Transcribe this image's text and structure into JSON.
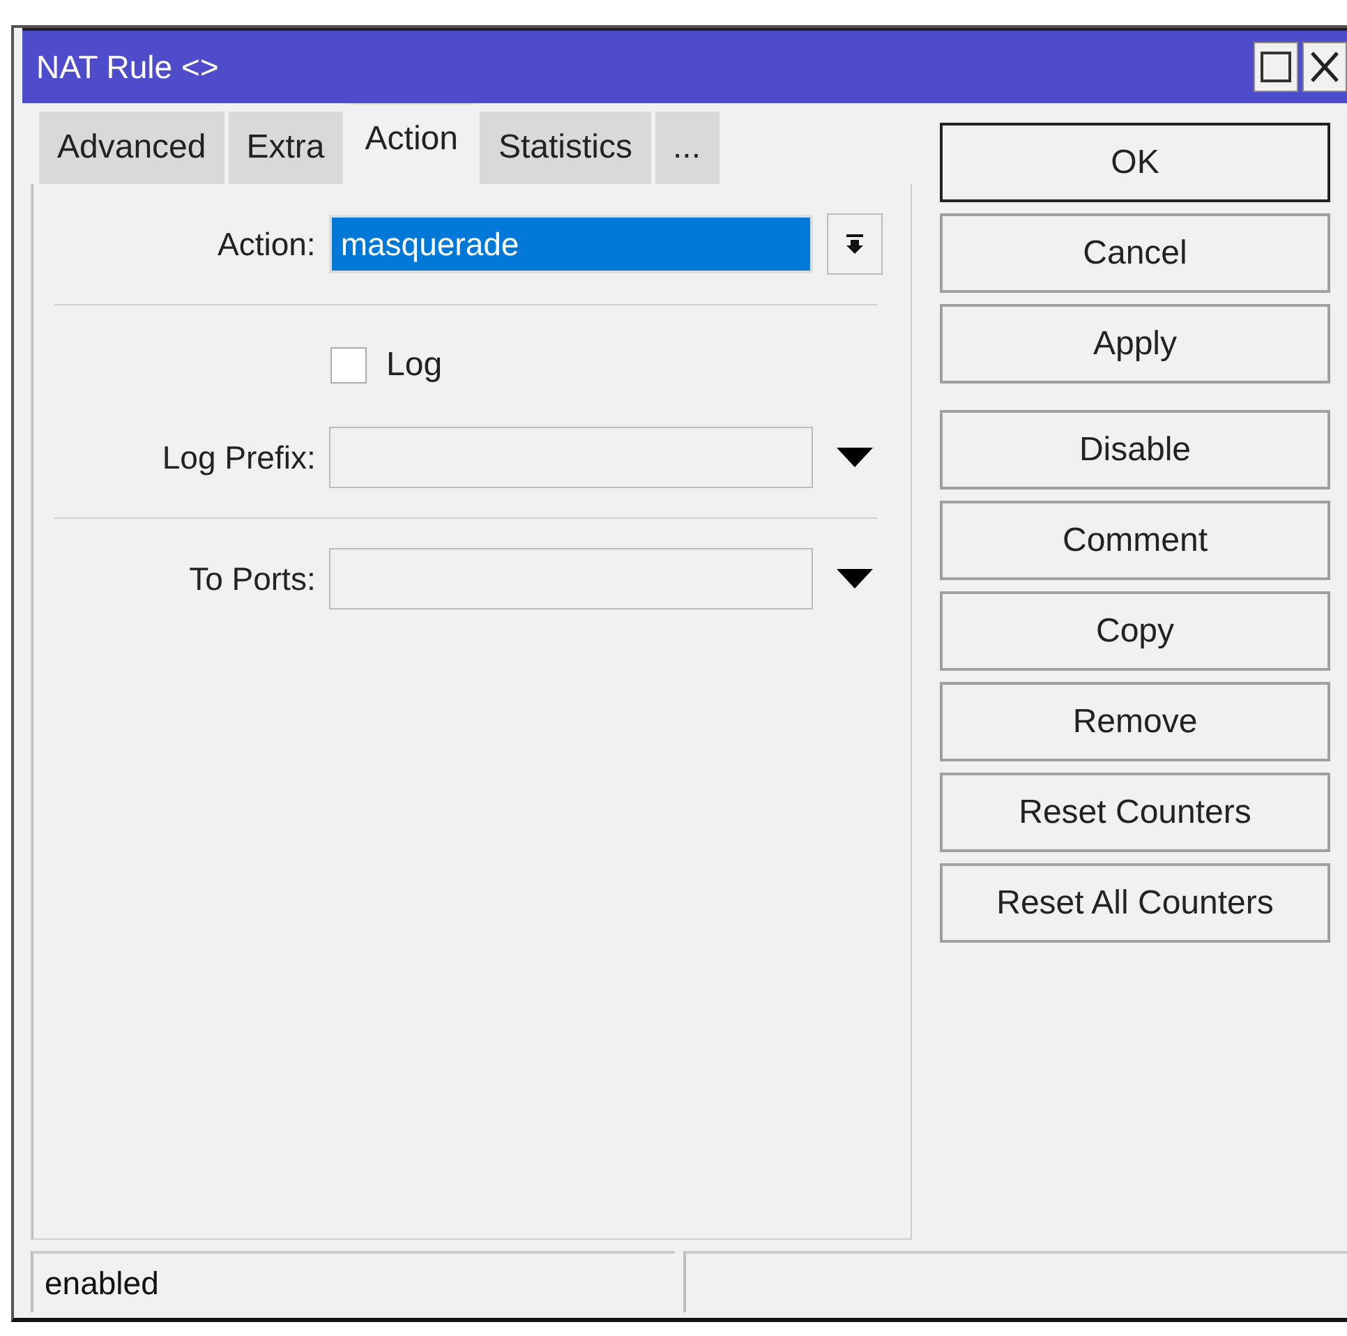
{
  "window": {
    "title": "NAT Rule <>"
  },
  "tabs": [
    {
      "label": "Advanced",
      "selected": false
    },
    {
      "label": "Extra",
      "selected": false
    },
    {
      "label": "Action",
      "selected": true
    },
    {
      "label": "Statistics",
      "selected": false
    },
    {
      "label": "...",
      "selected": false
    }
  ],
  "fields": [
    {
      "kind": "select",
      "label": "Action:",
      "value": "masquerade",
      "selected": true
    },
    {
      "kind": "checkbox",
      "label": "Log",
      "checked": false
    },
    {
      "kind": "combo",
      "label": "Log Prefix:"
    },
    {
      "kind": "combo",
      "label": "To Ports:"
    }
  ],
  "buttons": [
    {
      "label": "OK",
      "default": true
    },
    {
      "label": "Cancel",
      "default": false
    },
    {
      "label": "Apply",
      "default": false
    },
    {
      "label": "Disable",
      "default": false
    },
    {
      "label": "Comment",
      "default": false
    },
    {
      "label": "Copy",
      "default": false
    },
    {
      "label": "Remove",
      "default": false
    },
    {
      "label": "Reset Counters",
      "default": false
    },
    {
      "label": "Reset All Counters",
      "default": false
    }
  ],
  "status_bar": [
    "enabled"
  ]
}
